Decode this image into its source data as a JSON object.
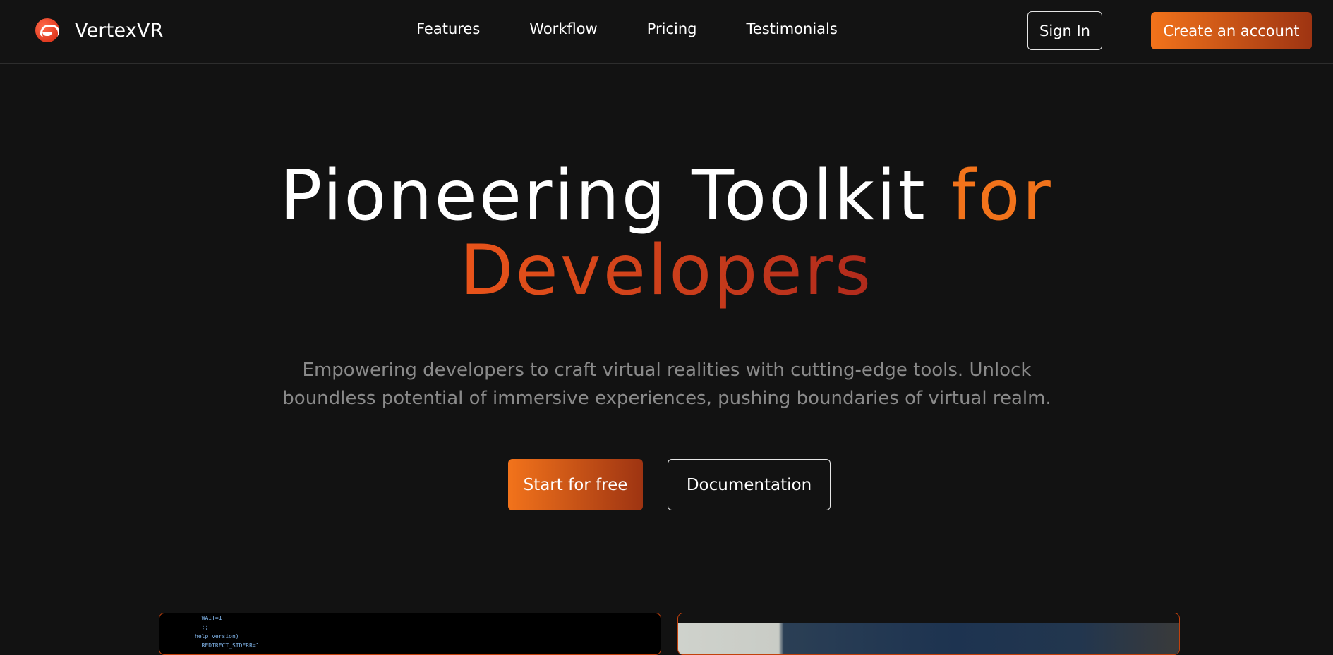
{
  "brand": {
    "name": "VertexVR",
    "logo_icon": "vr-headset-icon"
  },
  "nav": {
    "links": [
      "Features",
      "Workflow",
      "Pricing",
      "Testimonials"
    ]
  },
  "header": {
    "signin_label": "Sign In",
    "create_label": "Create an account"
  },
  "hero": {
    "title_part1": "Pioneering Toolkit ",
    "title_accent": "for",
    "title_part2": "Developers",
    "subtitle": "Empowering developers to craft virtual realities with cutting-edge tools. Unlock boundless potential of immersive experiences, pushing boundaries of virtual realm.",
    "start_label": "Start for free",
    "docs_label": "Documentation"
  },
  "preview": {
    "code_lines": [
      "  WAIT=1",
      "  ;;",
      "help|version)",
      "  REDIRECT_STDERR=1"
    ]
  },
  "colors": {
    "accent": "#f2731b",
    "accent_dark": "#9e3412",
    "background": "#121212"
  }
}
